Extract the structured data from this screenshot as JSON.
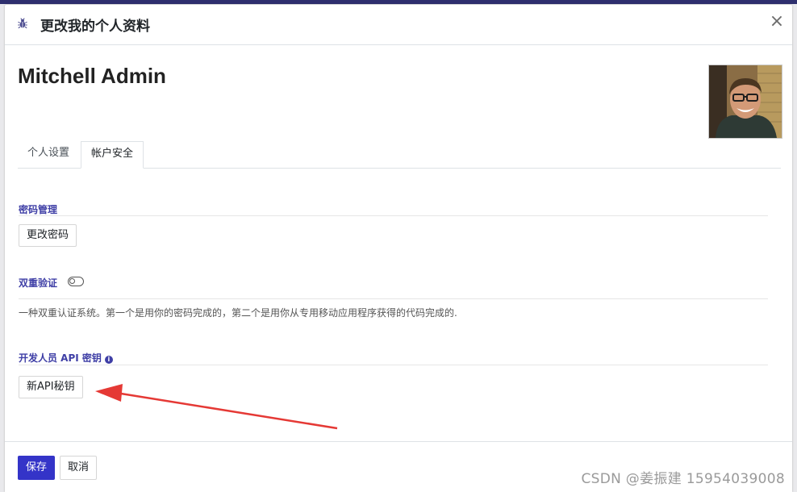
{
  "dialog": {
    "title": "更改我的个人资料",
    "close_label": "×",
    "bug_icon": "bug-icon"
  },
  "profile": {
    "name": "Mitchell Admin"
  },
  "tabs": [
    {
      "label": "个人设置",
      "active": false
    },
    {
      "label": "帐户安全",
      "active": true
    }
  ],
  "password_section": {
    "title": "密码管理",
    "button_label": "更改密码"
  },
  "two_factor": {
    "title": "双重验证",
    "enabled": false,
    "description": "一种双重认证系统。第一个是用你的密码完成的，第二个是用你从专用移动应用程序获得的代码完成的."
  },
  "api_keys": {
    "title": "开发人员 API 密钥",
    "info_icon": "i",
    "button_label": "新API秘钥"
  },
  "footer": {
    "save_label": "保存",
    "cancel_label": "取消"
  },
  "watermark": "CSDN @姜振建  15954039008",
  "colors": {
    "primary": "#3434c8",
    "section_title": "#3f3fa6",
    "annotation_arrow": "#e53935"
  }
}
